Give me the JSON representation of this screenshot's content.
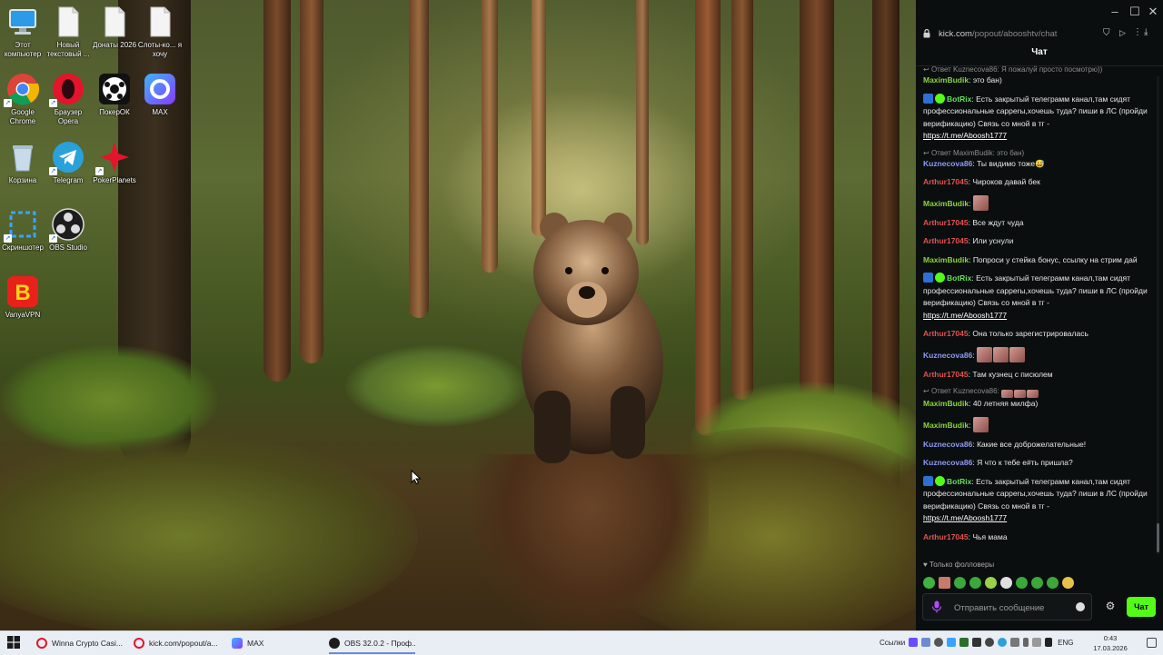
{
  "desktop": {
    "icons": [
      {
        "label": "Этот компьютер",
        "icon": "computer-icon"
      },
      {
        "label": "Новый текстовый ...",
        "icon": "text-file-icon"
      },
      {
        "label": "Донаты 2026",
        "icon": "text-file-icon"
      },
      {
        "label": "Слоты-ко... я хочу",
        "icon": "text-file-icon"
      },
      {
        "label": "Google Chrome",
        "icon": "chrome-icon"
      },
      {
        "label": "Браузер Opera",
        "icon": "opera-icon"
      },
      {
        "label": "ПокерОК",
        "icon": "pokerok-icon"
      },
      {
        "label": "MAX",
        "icon": "max-icon"
      },
      {
        "label": "Корзина",
        "icon": "recycle-bin-icon"
      },
      {
        "label": "Telegram",
        "icon": "telegram-icon"
      },
      {
        "label": "PokerPlanets",
        "icon": "pokerplanets-icon"
      },
      {
        "label": "Скриншотер",
        "icon": "screenshoter-icon"
      },
      {
        "label": "OBS Studio",
        "icon": "obs-icon"
      },
      {
        "label": "VanyaVPN",
        "icon": "vanyavpn-icon"
      }
    ]
  },
  "browser": {
    "url_host": "kick.com",
    "url_path": "/popout/abooshtv/chat"
  },
  "chat": {
    "header": "Чат",
    "messages": [
      {
        "reply": "Ответ Kuznecova86: Я пожалуй просто посмотрю))",
        "user": "MaximBudik",
        "text": "это бан)"
      },
      {
        "user": "BotRix",
        "text": "Есть закрытый телеграмм канал,там сидят профессиональные capperы,хочешь туда? пиши в ЛС (пройди верификацию) Связь со мной в тг -",
        "link": "https://t.me/Aboosh1777"
      },
      {
        "reply": "Ответ MaximBudik: это бан)",
        "user": "Kuznecova86",
        "text": "Ты видимо тоже😅"
      },
      {
        "user": "Arthur17045",
        "text": "Чироков давай бек"
      },
      {
        "user": "MaximBudik",
        "text": ""
      },
      {
        "user": "Arthur17045",
        "text": "Все ждут чуда"
      },
      {
        "user": "Arthur17045",
        "text": "Или уснули"
      },
      {
        "user": "MaximBudik",
        "text": "Попроси у стейка бонус, ссылку на стрим дай"
      },
      {
        "user": "BotRix",
        "text": "Есть закрытый телеграмм канал,там сидят профессиональные capperы,хочешь туда? пиши в ЛС (пройди верификацию) Связь со мной в тг -",
        "link": "https://t.me/Aboosh1777"
      },
      {
        "user": "Arthur17045",
        "text": "Она только зарегистрировалась"
      },
      {
        "user": "Kuznecova86",
        "text": ""
      },
      {
        "user": "Arthur17045",
        "text": "Там кузнец с писюлем"
      },
      {
        "reply": "Ответ Kuznecova86:",
        "user": "MaximBudik",
        "text": "40 летняя милфа)"
      },
      {
        "user": "MaximBudik",
        "text": ""
      },
      {
        "user": "Kuznecova86",
        "text": "Какие все доброжелательные!"
      },
      {
        "user": "Kuznecova86",
        "text": "Я что к тебе е#ть пришла?"
      },
      {
        "user": "BotRix",
        "text": "Есть закрытый телеграмм канал,там сидят профессиональные capperы,хочешь туда? пиши в ЛС (пройди верификацию) Связь со мной в тг -",
        "link": "https://t.me/Aboosh1777"
      },
      {
        "user": "Arthur17045",
        "text": "Чья мама"
      }
    ],
    "followers_only": "Только фолловеры",
    "input_placeholder": "Отправить сообщение",
    "send_label": "Чат"
  },
  "taskbar": {
    "items": [
      {
        "label": "Winna Crypto Casi...",
        "icon": "opera-icon"
      },
      {
        "label": "kick.com/popout/a...",
        "icon": "opera-icon"
      },
      {
        "label": "MAX",
        "icon": "max-icon"
      },
      {
        "label": "OBS 32.0.2 - Проф...",
        "icon": "obs-icon"
      }
    ],
    "links_label": "Ссылки",
    "lang": "ENG",
    "time": "0:43",
    "date": "17.03.2026"
  },
  "colors": {
    "kick_green": "#53fc18",
    "maximbudik": "#8ad53b",
    "kuznecova86": "#8e9cf3",
    "arthur17045": "#e2514f",
    "botrix": "#65df5a"
  }
}
